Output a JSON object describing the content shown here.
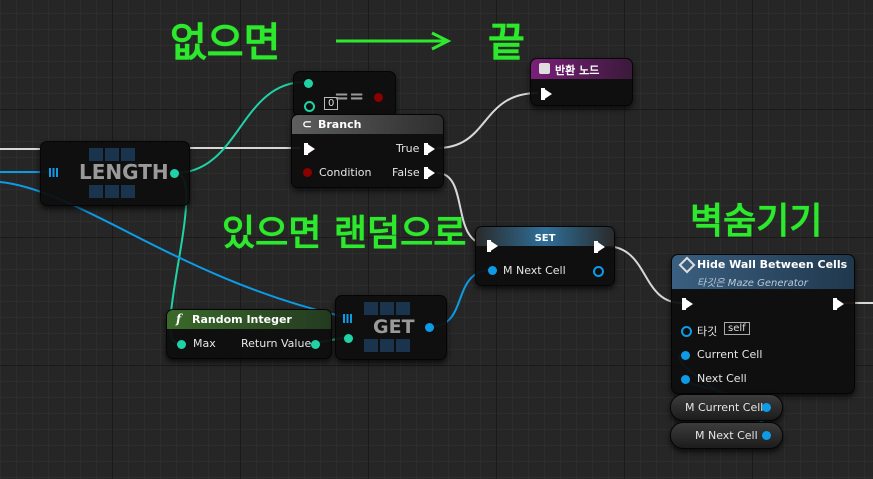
{
  "annotations": {
    "if_none": "없으면",
    "end": "끝",
    "if_exists_random": "있으면 랜덤으로",
    "break_wall": "벽숨기기"
  },
  "return_node": {
    "title": "반환 노드",
    "color": "#7a1f7a"
  },
  "equal_node": {
    "symbol": "==",
    "default_value": "0"
  },
  "branch_node": {
    "title": "Branch",
    "true_label": "True",
    "false_label": "False",
    "condition_label": "Condition"
  },
  "length_node": {
    "label": "LENGTH"
  },
  "set_node": {
    "title": "SET",
    "var_label": "M Next Cell"
  },
  "random_node": {
    "title": "Random Integer",
    "max_label": "Max",
    "return_label": "Return Value"
  },
  "get_node": {
    "label": "GET"
  },
  "hide_wall_node": {
    "title": "Hide Wall Between Cells",
    "subtitle": "타깃은 Maze Generator",
    "target_label": "타깃",
    "target_value": "self",
    "current_cell_label": "Current Cell",
    "next_cell_label": "Next Cell"
  },
  "var_current": {
    "label": "M Current Cell"
  },
  "var_next": {
    "label": "M Next Cell"
  },
  "colors": {
    "exec": "#ffffff",
    "bool": "#8c0000",
    "int": "#1fd3a6",
    "struct": "#0d9be8",
    "annotation": "#2ee82e"
  }
}
